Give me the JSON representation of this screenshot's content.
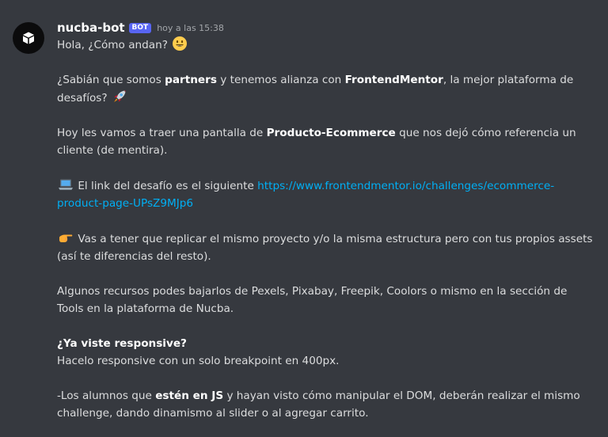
{
  "message": {
    "author": "nucba-bot",
    "badge": "BOT",
    "timestamp": "hoy a las 15:38",
    "avatar_icon": "cube-icon",
    "p1_text": "Hola, ¿Cómo andan?",
    "p1_emoji": "smiley-emoji",
    "p2_a": "¿Sabián que somos ",
    "p2_bold1": "partners",
    "p2_b": " y tenemos alianza con ",
    "p2_bold2": "FrontendMentor",
    "p2_c": ", la mejor plataforma de desafíos?",
    "p2_emoji": "rocket-emoji",
    "p3_a": "Hoy les vamos a traer una pantalla de ",
    "p3_bold": "Producto-Ecommerce",
    "p3_b": " que nos dejó cómo referencia un cliente (de mentira).",
    "p4_emoji": "laptop-emoji",
    "p4_text": " El link del desafío es el siguiente ",
    "p4_link": "https://www.frontendmentor.io/challenges/ecommerce-product-page-UPsZ9MJp6",
    "p5_emoji": "pointing-hand-emoji",
    "p5_text": " Vas a tener que replicar el mismo proyecto y/o la misma estructura pero con tus propios assets (así te diferencias del resto).",
    "p6_text": "Algunos recursos podes bajarlos de Pexels, Pixabay, Freepik, Coolors o mismo en la sección de Tools en la plataforma de Nucba.",
    "p7_bold": "¿Ya viste responsive?",
    "p7_text": "Hacelo responsive con un solo breakpoint en 400px.",
    "p8_a": "-Los alumnos que ",
    "p8_bold": "estén en JS",
    "p8_b": " y hayan visto cómo manipular el DOM, deberán realizar el mismo challenge, dando dinamismo al slider o al agregar carrito."
  },
  "colors": {
    "background": "#36393f",
    "text": "#dcddde",
    "link": "#00aff4",
    "badge": "#5865f2"
  }
}
